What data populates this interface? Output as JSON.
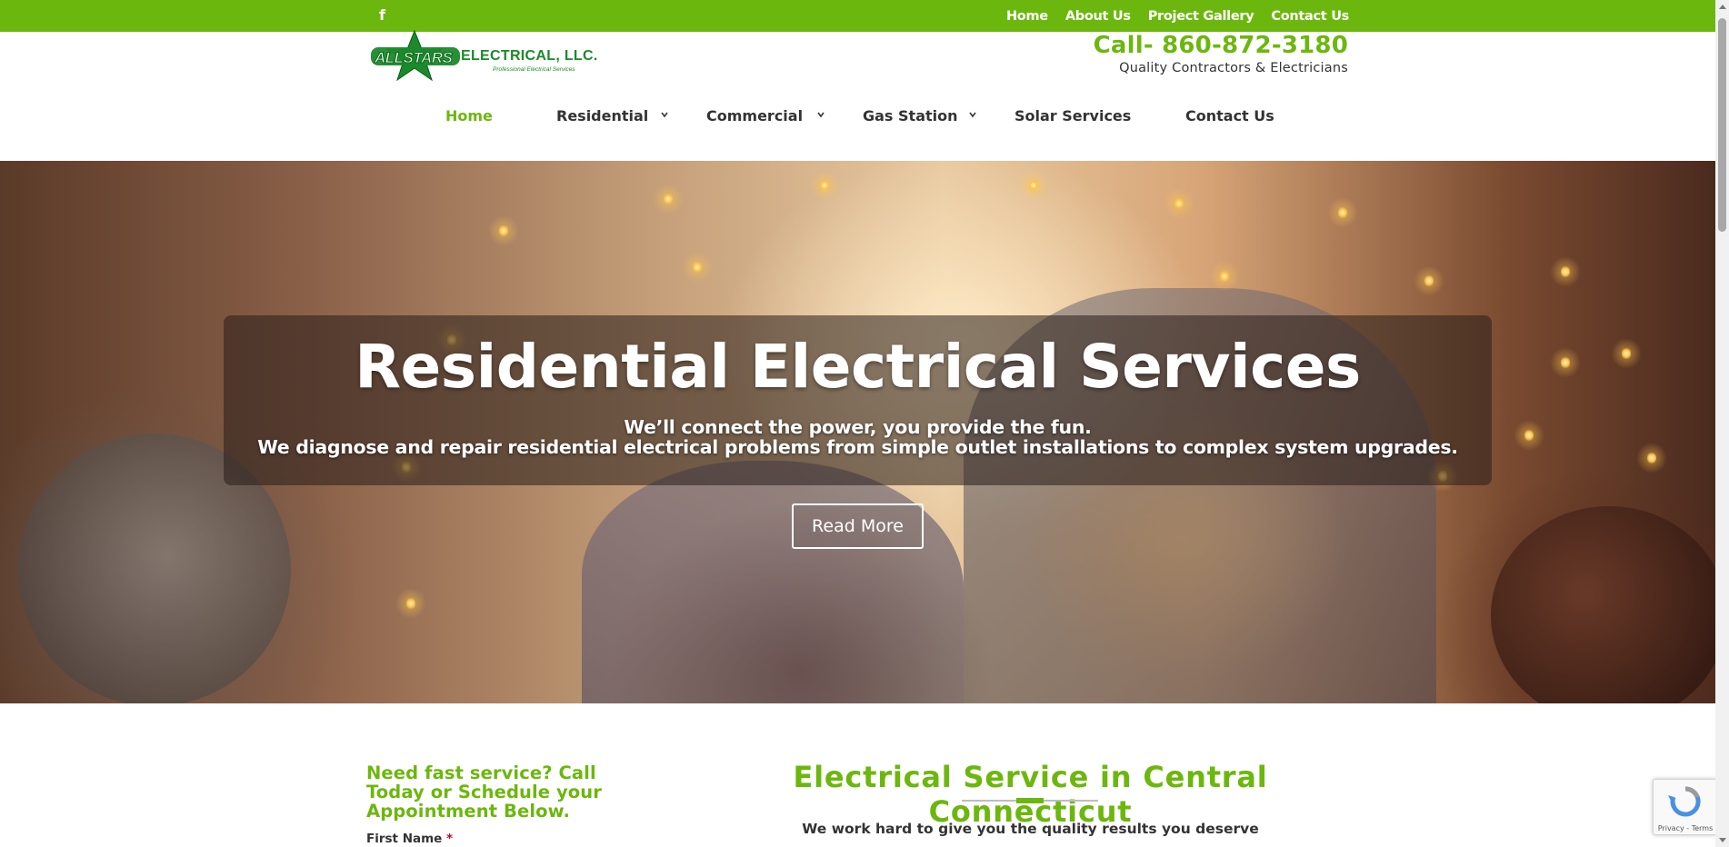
{
  "topbar": {
    "social_icon": "facebook-icon",
    "social_glyph": "f",
    "links": [
      "Home",
      "About Us",
      "Project Gallery",
      "Contact Us"
    ],
    "background": "#6cb70e"
  },
  "header": {
    "logo_brand": "ALLSTARS",
    "logo_name": "ELECTRICAL, LLC.",
    "logo_tagline": "Professional Electrical Services",
    "phone": "Call- 860-872-3180",
    "tagline": "Quality Contractors & Electricians"
  },
  "nav": {
    "items": [
      {
        "label": "Home",
        "active": true,
        "dropdown": false
      },
      {
        "label": "Residential",
        "active": false,
        "dropdown": true
      },
      {
        "label": "Commercial",
        "active": false,
        "dropdown": true
      },
      {
        "label": "Gas Station",
        "active": false,
        "dropdown": true
      },
      {
        "label": "Solar Services",
        "active": false,
        "dropdown": false
      },
      {
        "label": "Contact Us",
        "active": false,
        "dropdown": false
      }
    ],
    "active_color": "#6cb70e"
  },
  "hero": {
    "title": "Residential Electrical Services",
    "subtitle_line1": "We’ll connect the power, you provide the fun.",
    "subtitle_line2": "We diagnose and repair residential electrical problems from simple outlet installations to complex system upgrades.",
    "button": "Read More"
  },
  "cta": {
    "text": "Need fast service? Call Today or Schedule your Appointment Below.",
    "first_name_label": "First Name",
    "required_mark": "*"
  },
  "section": {
    "title": "Electrical Service in Central Connecticut",
    "text": "We work hard to give you the quality results you deserve"
  },
  "recaptcha": {
    "terms": "Privacy - Terms"
  },
  "colors": {
    "brand_green": "#6cb70e",
    "text_dark": "#333333"
  }
}
